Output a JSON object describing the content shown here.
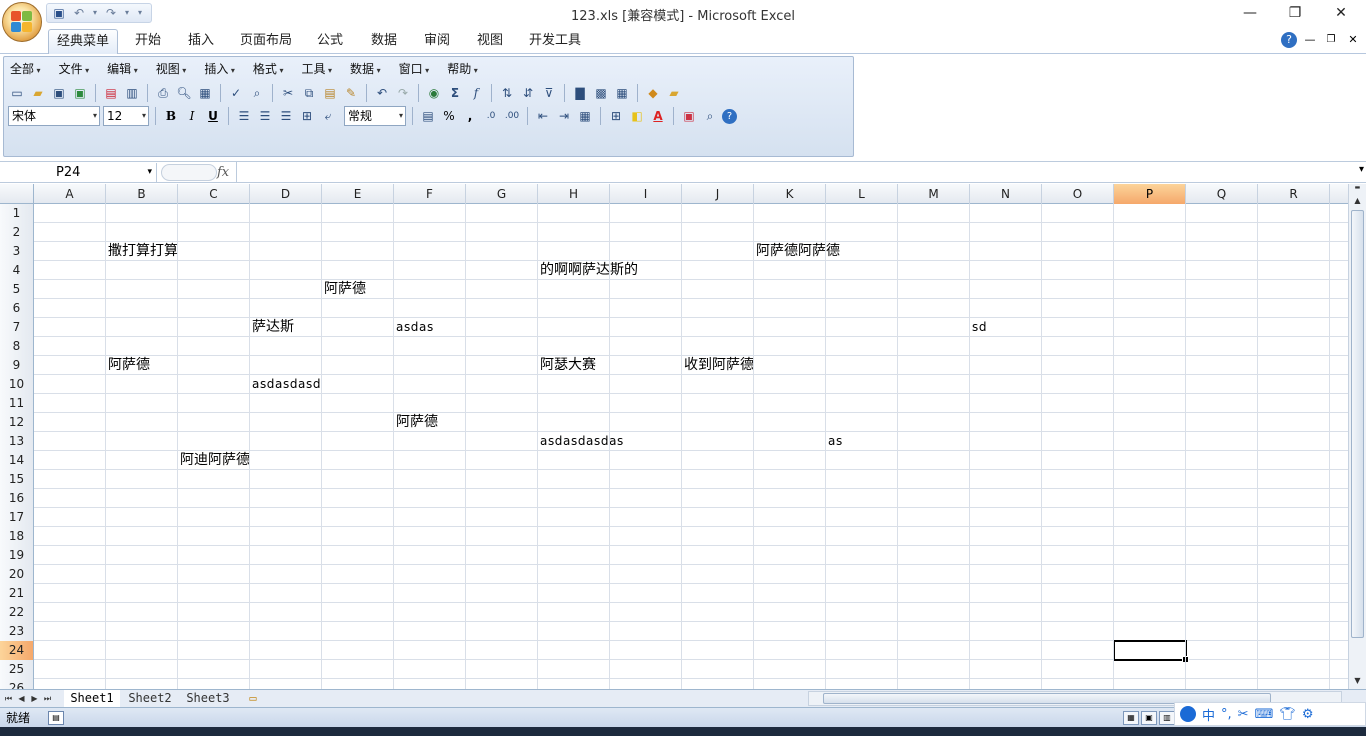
{
  "window": {
    "title": "123.xls  [兼容模式] - Microsoft Excel",
    "controls": {
      "minimize": "—",
      "restore": "❐",
      "close": "✕"
    }
  },
  "ribbon": {
    "tabs": [
      "经典菜单",
      "开始",
      "插入",
      "页面布局",
      "公式",
      "数据",
      "审阅",
      "视图",
      "开发工具"
    ],
    "active_tab": "经典菜单",
    "menus": [
      "全部",
      "文件",
      "编辑",
      "视图",
      "插入",
      "格式",
      "工具",
      "数据",
      "窗口",
      "帮助"
    ],
    "font_name": "宋体",
    "font_size": "12",
    "number_format": "常规",
    "percent_symbol": "%",
    "comma_symbol": ","
  },
  "formula_bar": {
    "name_box": "P24",
    "fx": "fx",
    "value": ""
  },
  "columns": [
    "A",
    "B",
    "C",
    "D",
    "E",
    "F",
    "G",
    "H",
    "I",
    "J",
    "K",
    "L",
    "M",
    "N",
    "O",
    "P",
    "Q",
    "R"
  ],
  "selected_column": "P",
  "rows": [
    "1",
    "2",
    "3",
    "4",
    "5",
    "6",
    "7",
    "8",
    "9",
    "10",
    "11",
    "12",
    "13",
    "14",
    "15",
    "16",
    "17",
    "18",
    "19",
    "20",
    "21",
    "22",
    "23",
    "24",
    "25",
    "26"
  ],
  "selected_row": "24",
  "cells": [
    {
      "ref": "B3",
      "value": "撒打算打算"
    },
    {
      "ref": "K3",
      "value": "阿萨德阿萨德"
    },
    {
      "ref": "H4",
      "value": "的啊啊萨达斯的"
    },
    {
      "ref": "E5",
      "value": "阿萨德"
    },
    {
      "ref": "D7",
      "value": "萨达斯"
    },
    {
      "ref": "F7",
      "value": "asdas"
    },
    {
      "ref": "N7",
      "value": "sd"
    },
    {
      "ref": "B9",
      "value": "阿萨德"
    },
    {
      "ref": "H9",
      "value": "阿瑟大赛"
    },
    {
      "ref": "J9",
      "value": "收到阿萨德"
    },
    {
      "ref": "D10",
      "value": "asdasdasd"
    },
    {
      "ref": "F12",
      "value": "阿萨德"
    },
    {
      "ref": "H13",
      "value": "asdasdasdas"
    },
    {
      "ref": "L13",
      "value": "as"
    },
    {
      "ref": "C14",
      "value": "阿迪阿萨德"
    }
  ],
  "sheets": [
    "Sheet1",
    "Sheet2",
    "Sheet3"
  ],
  "active_sheet": "Sheet1",
  "status": {
    "text": "就绪"
  },
  "ime": {
    "label": "中"
  },
  "colors": {
    "selected_header": "#f8b26f",
    "grid_line": "#d9dfe8",
    "ribbon_panel": "#dce6f3"
  }
}
